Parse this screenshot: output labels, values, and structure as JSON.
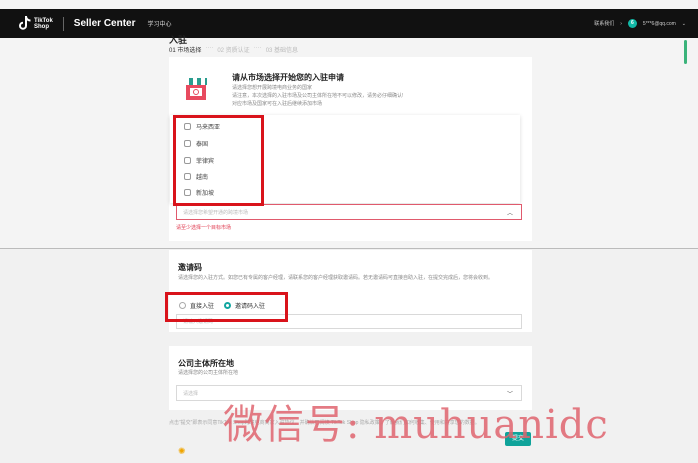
{
  "header": {
    "logo_text_line1": "TikTok",
    "logo_text_line2": "Shop",
    "brand": "Seller Center",
    "nav_learn": "学习中心",
    "contact": "联系我们",
    "avatar_letter": "6",
    "account": "5***6@qq.com"
  },
  "page": {
    "title": "入驻",
    "steps": [
      "01 市场选择",
      "02 资质认证",
      "03 基础信息"
    ],
    "step_sep": "····"
  },
  "intro": {
    "title": "请从市场选择开始您的入驻申请",
    "lines": [
      "请选择您想开展跨境电商业务的国家",
      "请注意，本次选择的入驻市场及公司主体所在地不可以修改，请务必仔细确认!",
      "对应市场及国家可在入驻后继续添加市场"
    ]
  },
  "market": {
    "options": [
      "马来西亚",
      "泰国",
      "菲律宾",
      "越南",
      "新加坡"
    ],
    "placeholder": "请选择您希望开通的跨境市场",
    "error": "请至少选择一个目标市场"
  },
  "invite": {
    "title": "邀请码",
    "desc": "请选择您的入驻方式。如您已有专属的客户经理，请联系您的客户经理获取邀请码。若无邀请码可直接自助入驻，在提交完成后，您将会收到。",
    "radio_direct": "直接入驻",
    "radio_code": "邀请码入驻",
    "input_placeholder": "请输入邀请码"
  },
  "company": {
    "title": "公司主体所在地",
    "desc": "请选择您的公司主体所在地",
    "placeholder": "请选择"
  },
  "footer": {
    "note": "点击“提交”即表示同意TikTok Shop跨境电商商家入驻协议，并确认已阅读 TikTok Shop 隐私政策，了解我们如何收集、使用和共享您的数据。",
    "submit": "提交"
  },
  "watermark": "微信号: muhuanidc",
  "colors": {
    "accent": "#0fa39a",
    "highlight": "#d9131b",
    "error": "#e0394e"
  }
}
